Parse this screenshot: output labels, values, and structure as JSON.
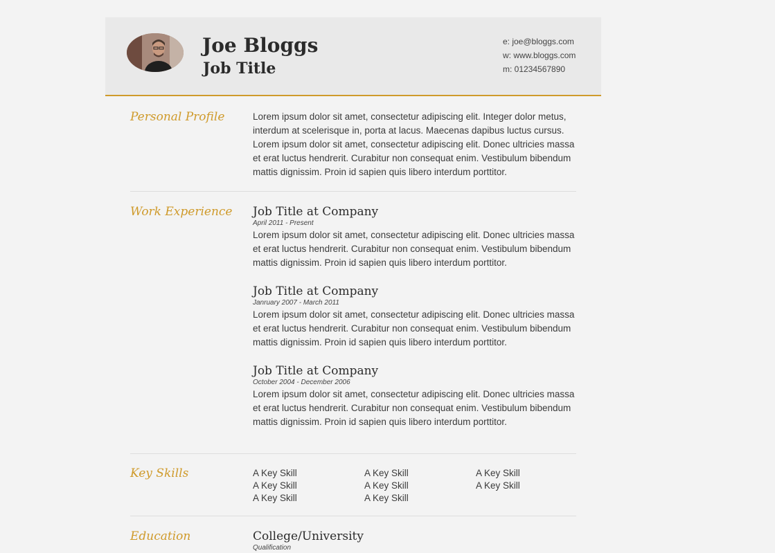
{
  "header": {
    "name": "Joe Bloggs",
    "job_title": "Job Title",
    "contact": {
      "email": "e: joe@bloggs.com",
      "website": "w: www.bloggs.com",
      "mobile": "m: 01234567890"
    }
  },
  "colors": {
    "accent": "#cf9a2a",
    "header_bg": "#e9e9e9",
    "page_bg": "#f3f3f3"
  },
  "profile": {
    "title": "Personal Profile",
    "text": "Lorem ipsum dolor sit amet, consectetur adipiscing elit. Integer dolor metus, interdum at scelerisque in, porta at lacus. Maecenas dapibus luctus cursus. Lorem ipsum dolor sit amet, consectetur adipiscing elit. Donec ultricies massa et erat luctus hendrerit. Curabitur non consequat enim. Vestibulum bibendum mattis dignissim. Proin id sapien quis libero interdum porttitor."
  },
  "experience": {
    "title": "Work Experience",
    "jobs": [
      {
        "title": "Job Title at Company",
        "dates": "April 2011 - Present",
        "description": "Lorem ipsum dolor sit amet, consectetur adipiscing elit. Donec ultricies massa et erat luctus hendrerit. Curabitur non consequat enim. Vestibulum bibendum mattis dignissim. Proin id sapien quis libero interdum porttitor."
      },
      {
        "title": "Job Title at Company",
        "dates": "Janruary 2007 - March 2011",
        "description": "Lorem ipsum dolor sit amet, consectetur adipiscing elit. Donec ultricies massa et erat luctus hendrerit. Curabitur non consequat enim. Vestibulum bibendum mattis dignissim. Proin id sapien quis libero interdum porttitor."
      },
      {
        "title": "Job Title at Company",
        "dates": "October 2004 - December 2006",
        "description": "Lorem ipsum dolor sit amet, consectetur adipiscing elit. Donec ultricies massa et erat luctus hendrerit. Curabitur non consequat enim. Vestibulum bibendum mattis dignissim. Proin id sapien quis libero interdum porttitor."
      }
    ]
  },
  "skills": {
    "title": "Key Skills",
    "items": [
      "A Key Skill",
      "A Key Skill",
      "A Key Skill",
      "A Key Skill",
      "A Key Skill",
      "A Key Skill",
      "A Key Skill",
      "A Key Skill"
    ]
  },
  "education": {
    "title": "Education",
    "institution": "College/University",
    "qualification": "Qualification"
  }
}
